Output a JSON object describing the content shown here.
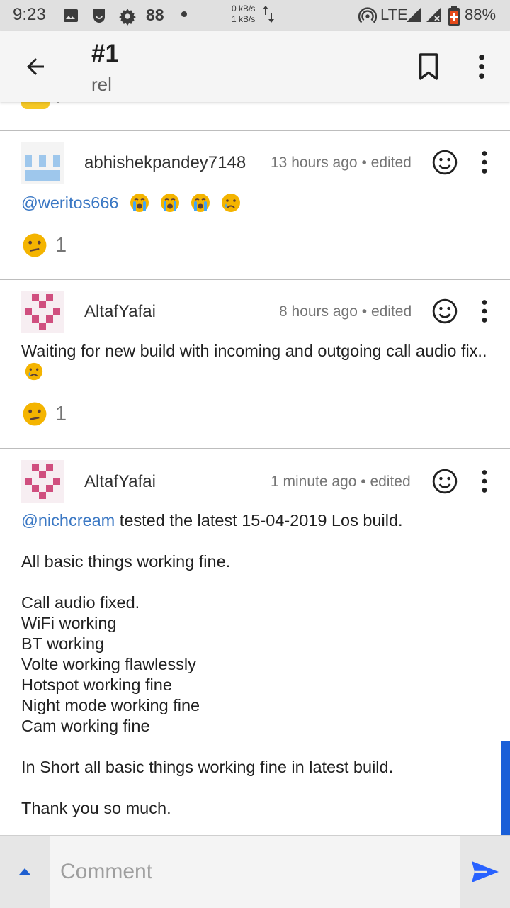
{
  "status_bar": {
    "time": "9:23",
    "notification_count": "88",
    "net_up": "0 kB/s",
    "net_down": "1 kB/s",
    "network": "LTE",
    "battery": "88%"
  },
  "app_bar": {
    "title": "#1",
    "subtitle": "rel"
  },
  "comments": [
    {
      "username": "abhishekpandey7148",
      "time": "13 hours ago",
      "edited": "• edited",
      "mention": "@weritos666",
      "reaction_count": "1"
    },
    {
      "username": "AltafYafai",
      "time": "8 hours ago",
      "edited": "• edited",
      "text": "Waiting for new build with incoming and outgoing call audio fix..",
      "reaction_count": "1"
    },
    {
      "username": "AltafYafai",
      "time": "1 minute ago",
      "edited": "• edited",
      "mention": "@nichcream",
      "line1": " tested the latest 15-04-2019 Los build.",
      "line2": "All basic things working fine.",
      "list": [
        "Call audio fixed.",
        "WiFi working",
        "BT working",
        "Volte working flawlessly",
        "Hotspot working fine",
        "Night mode working fine",
        "Cam working fine"
      ],
      "line3": "In Short all basic things working fine in latest build.",
      "line4": "Thank you so much."
    }
  ],
  "composer": {
    "placeholder": "Comment"
  },
  "colors": {
    "mention": "#3b78c4",
    "send": "#2962ff",
    "scrollbar": "#1a5fd8"
  }
}
